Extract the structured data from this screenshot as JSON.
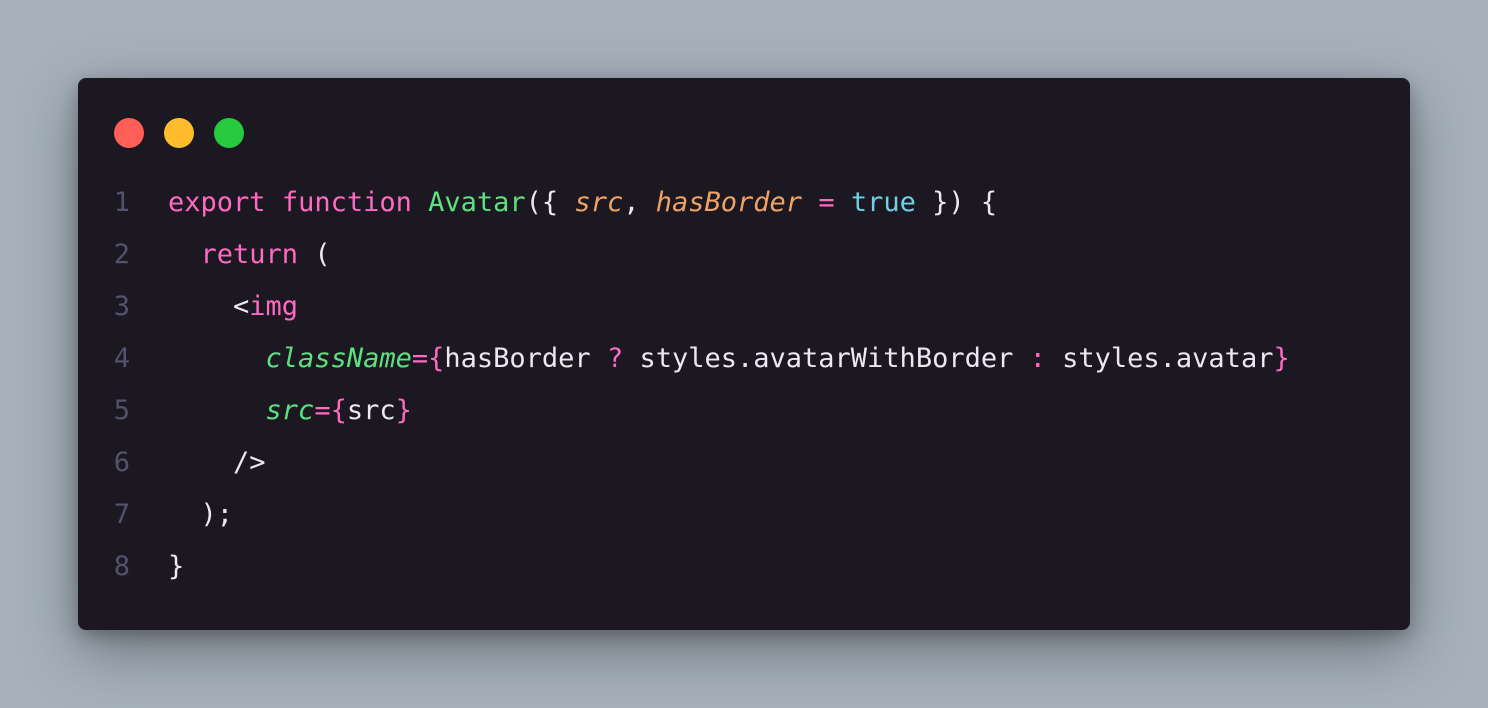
{
  "window": {
    "dots": [
      {
        "name": "close",
        "color": "#ff5f56"
      },
      {
        "name": "minimize",
        "color": "#ffbd2e"
      },
      {
        "name": "maximize",
        "color": "#27c93f"
      }
    ]
  },
  "colors": {
    "background": "#a6b1bc",
    "editor_bg": "#1b1822",
    "keyword": "#ff6ac1",
    "function": "#5ce17f",
    "parameter": "#f0a262",
    "boolean": "#6fd0e5",
    "text": "#ece8f3",
    "line_number": "#55506d"
  },
  "code": {
    "line_numbers": [
      "1",
      "2",
      "3",
      "4",
      "5",
      "6",
      "7",
      "8"
    ],
    "l1": {
      "t1": "export",
      "t2": " ",
      "t3": "function",
      "t4": " ",
      "t5": "Avatar",
      "t6": "({ ",
      "t7": "src",
      "t8": ", ",
      "t9": "hasBorder",
      "t10": " ",
      "t11": "=",
      "t12": " ",
      "t13": "true",
      "t14": " }) {"
    },
    "l2": {
      "indent": "  ",
      "t1": "return",
      "t2": " ("
    },
    "l3": {
      "indent": "    ",
      "t1": "<",
      "t2": "img"
    },
    "l4": {
      "indent": "      ",
      "t1": "className",
      "t2": "=",
      "t3": "{",
      "t4": "hasBorder ",
      "t5": "?",
      "t6": " styles.avatarWithBorder ",
      "t7": ":",
      "t8": " styles.avatar",
      "t9": "}"
    },
    "l5": {
      "indent": "      ",
      "t1": "src",
      "t2": "=",
      "t3": "{",
      "t4": "src",
      "t5": "}"
    },
    "l6": {
      "indent": "    ",
      "t1": "/>"
    },
    "l7": {
      "indent": "  ",
      "t1": ");"
    },
    "l8": {
      "t1": "}"
    }
  }
}
